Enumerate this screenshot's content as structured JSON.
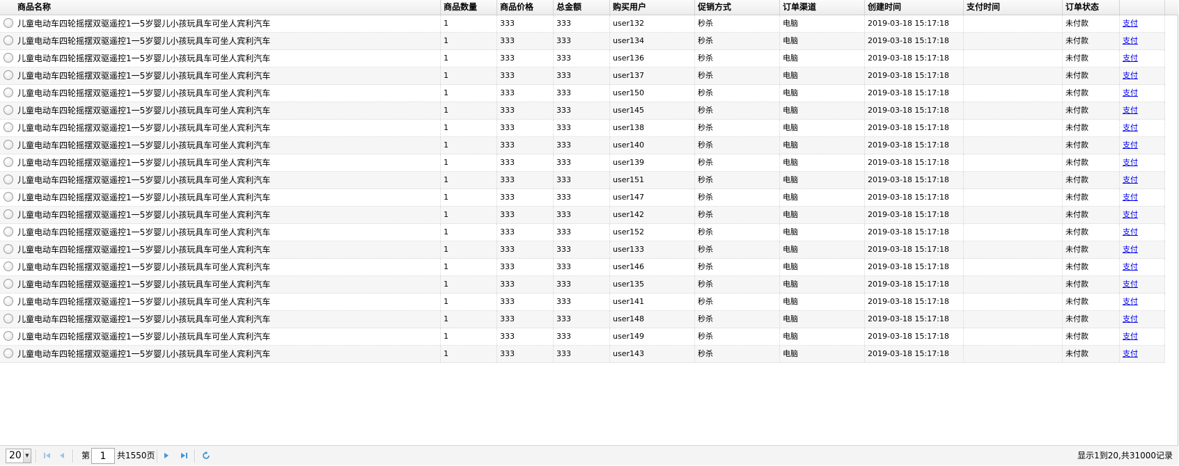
{
  "columns": [
    "商品名称",
    "商品数量",
    "商品价格",
    "总金额",
    "购买用户",
    "促销方式",
    "订单渠道",
    "创建时间",
    "支付时间",
    "订单状态",
    ""
  ],
  "rows": [
    {
      "name": "儿童电动车四轮摇摆双驱遥控1一5岁婴儿小孩玩具车可坐人宾利汽车",
      "qty": "1",
      "price": "333",
      "total": "333",
      "user": "user132",
      "promo": "秒杀",
      "channel": "电脑",
      "created": "2019-03-18 15:17:18",
      "paid": "",
      "status": "未付款",
      "action": "支付"
    },
    {
      "name": "儿童电动车四轮摇摆双驱遥控1一5岁婴儿小孩玩具车可坐人宾利汽车",
      "qty": "1",
      "price": "333",
      "total": "333",
      "user": "user134",
      "promo": "秒杀",
      "channel": "电脑",
      "created": "2019-03-18 15:17:18",
      "paid": "",
      "status": "未付款",
      "action": "支付"
    },
    {
      "name": "儿童电动车四轮摇摆双驱遥控1一5岁婴儿小孩玩具车可坐人宾利汽车",
      "qty": "1",
      "price": "333",
      "total": "333",
      "user": "user136",
      "promo": "秒杀",
      "channel": "电脑",
      "created": "2019-03-18 15:17:18",
      "paid": "",
      "status": "未付款",
      "action": "支付"
    },
    {
      "name": "儿童电动车四轮摇摆双驱遥控1一5岁婴儿小孩玩具车可坐人宾利汽车",
      "qty": "1",
      "price": "333",
      "total": "333",
      "user": "user137",
      "promo": "秒杀",
      "channel": "电脑",
      "created": "2019-03-18 15:17:18",
      "paid": "",
      "status": "未付款",
      "action": "支付"
    },
    {
      "name": "儿童电动车四轮摇摆双驱遥控1一5岁婴儿小孩玩具车可坐人宾利汽车",
      "qty": "1",
      "price": "333",
      "total": "333",
      "user": "user150",
      "promo": "秒杀",
      "channel": "电脑",
      "created": "2019-03-18 15:17:18",
      "paid": "",
      "status": "未付款",
      "action": "支付"
    },
    {
      "name": "儿童电动车四轮摇摆双驱遥控1一5岁婴儿小孩玩具车可坐人宾利汽车",
      "qty": "1",
      "price": "333",
      "total": "333",
      "user": "user145",
      "promo": "秒杀",
      "channel": "电脑",
      "created": "2019-03-18 15:17:18",
      "paid": "",
      "status": "未付款",
      "action": "支付"
    },
    {
      "name": "儿童电动车四轮摇摆双驱遥控1一5岁婴儿小孩玩具车可坐人宾利汽车",
      "qty": "1",
      "price": "333",
      "total": "333",
      "user": "user138",
      "promo": "秒杀",
      "channel": "电脑",
      "created": "2019-03-18 15:17:18",
      "paid": "",
      "status": "未付款",
      "action": "支付"
    },
    {
      "name": "儿童电动车四轮摇摆双驱遥控1一5岁婴儿小孩玩具车可坐人宾利汽车",
      "qty": "1",
      "price": "333",
      "total": "333",
      "user": "user140",
      "promo": "秒杀",
      "channel": "电脑",
      "created": "2019-03-18 15:17:18",
      "paid": "",
      "status": "未付款",
      "action": "支付"
    },
    {
      "name": "儿童电动车四轮摇摆双驱遥控1一5岁婴儿小孩玩具车可坐人宾利汽车",
      "qty": "1",
      "price": "333",
      "total": "333",
      "user": "user139",
      "promo": "秒杀",
      "channel": "电脑",
      "created": "2019-03-18 15:17:18",
      "paid": "",
      "status": "未付款",
      "action": "支付"
    },
    {
      "name": "儿童电动车四轮摇摆双驱遥控1一5岁婴儿小孩玩具车可坐人宾利汽车",
      "qty": "1",
      "price": "333",
      "total": "333",
      "user": "user151",
      "promo": "秒杀",
      "channel": "电脑",
      "created": "2019-03-18 15:17:18",
      "paid": "",
      "status": "未付款",
      "action": "支付"
    },
    {
      "name": "儿童电动车四轮摇摆双驱遥控1一5岁婴儿小孩玩具车可坐人宾利汽车",
      "qty": "1",
      "price": "333",
      "total": "333",
      "user": "user147",
      "promo": "秒杀",
      "channel": "电脑",
      "created": "2019-03-18 15:17:18",
      "paid": "",
      "status": "未付款",
      "action": "支付"
    },
    {
      "name": "儿童电动车四轮摇摆双驱遥控1一5岁婴儿小孩玩具车可坐人宾利汽车",
      "qty": "1",
      "price": "333",
      "total": "333",
      "user": "user142",
      "promo": "秒杀",
      "channel": "电脑",
      "created": "2019-03-18 15:17:18",
      "paid": "",
      "status": "未付款",
      "action": "支付"
    },
    {
      "name": "儿童电动车四轮摇摆双驱遥控1一5岁婴儿小孩玩具车可坐人宾利汽车",
      "qty": "1",
      "price": "333",
      "total": "333",
      "user": "user152",
      "promo": "秒杀",
      "channel": "电脑",
      "created": "2019-03-18 15:17:18",
      "paid": "",
      "status": "未付款",
      "action": "支付"
    },
    {
      "name": "儿童电动车四轮摇摆双驱遥控1一5岁婴儿小孩玩具车可坐人宾利汽车",
      "qty": "1",
      "price": "333",
      "total": "333",
      "user": "user133",
      "promo": "秒杀",
      "channel": "电脑",
      "created": "2019-03-18 15:17:18",
      "paid": "",
      "status": "未付款",
      "action": "支付"
    },
    {
      "name": "儿童电动车四轮摇摆双驱遥控1一5岁婴儿小孩玩具车可坐人宾利汽车",
      "qty": "1",
      "price": "333",
      "total": "333",
      "user": "user146",
      "promo": "秒杀",
      "channel": "电脑",
      "created": "2019-03-18 15:17:18",
      "paid": "",
      "status": "未付款",
      "action": "支付"
    },
    {
      "name": "儿童电动车四轮摇摆双驱遥控1一5岁婴儿小孩玩具车可坐人宾利汽车",
      "qty": "1",
      "price": "333",
      "total": "333",
      "user": "user135",
      "promo": "秒杀",
      "channel": "电脑",
      "created": "2019-03-18 15:17:18",
      "paid": "",
      "status": "未付款",
      "action": "支付"
    },
    {
      "name": "儿童电动车四轮摇摆双驱遥控1一5岁婴儿小孩玩具车可坐人宾利汽车",
      "qty": "1",
      "price": "333",
      "total": "333",
      "user": "user141",
      "promo": "秒杀",
      "channel": "电脑",
      "created": "2019-03-18 15:17:18",
      "paid": "",
      "status": "未付款",
      "action": "支付"
    },
    {
      "name": "儿童电动车四轮摇摆双驱遥控1一5岁婴儿小孩玩具车可坐人宾利汽车",
      "qty": "1",
      "price": "333",
      "total": "333",
      "user": "user148",
      "promo": "秒杀",
      "channel": "电脑",
      "created": "2019-03-18 15:17:18",
      "paid": "",
      "status": "未付款",
      "action": "支付"
    },
    {
      "name": "儿童电动车四轮摇摆双驱遥控1一5岁婴儿小孩玩具车可坐人宾利汽车",
      "qty": "1",
      "price": "333",
      "total": "333",
      "user": "user149",
      "promo": "秒杀",
      "channel": "电脑",
      "created": "2019-03-18 15:17:18",
      "paid": "",
      "status": "未付款",
      "action": "支付"
    },
    {
      "name": "儿童电动车四轮摇摆双驱遥控1一5岁婴儿小孩玩具车可坐人宾利汽车",
      "qty": "1",
      "price": "333",
      "total": "333",
      "user": "user143",
      "promo": "秒杀",
      "channel": "电脑",
      "created": "2019-03-18 15:17:18",
      "paid": "",
      "status": "未付款",
      "action": "支付"
    }
  ],
  "pager": {
    "page_size": "20",
    "page_prefix": "第",
    "current_page": "1",
    "total_pages_text": "共1550页",
    "info_text": "显示1到20,共31000记录",
    "icons": [
      "first-page-icon",
      "prev-page-icon",
      "next-page-icon",
      "last-page-icon",
      "refresh-icon"
    ]
  },
  "colors": {
    "link": "#0000ee",
    "pager_icon": "#4aa0d8",
    "row_alt": "#f6f6f6"
  }
}
